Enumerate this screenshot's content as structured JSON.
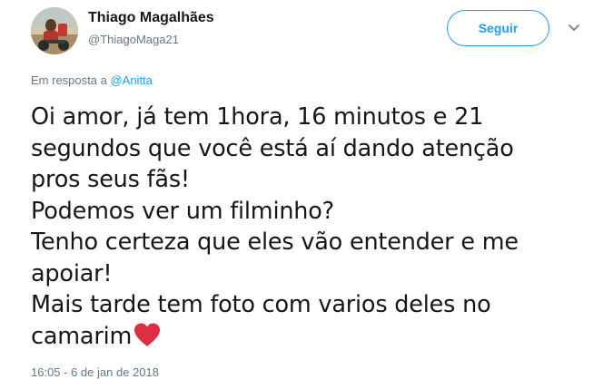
{
  "author": {
    "name": "Thiago Magalhães",
    "handle": "@ThiagoMaga21",
    "avatar_icon": "profile-photo"
  },
  "follow_button": {
    "label": "Seguir",
    "color": "#1da1f2"
  },
  "menu_icon": "chevron-down-icon",
  "reply_to": {
    "prefix": "Em resposta a",
    "mention": "@Anitta"
  },
  "tweet": {
    "lines": [
      "Oi amor, já tem 1hora, 16 minutos e 21",
      "segundos que você está aí dando atenção",
      "pros seus fãs!",
      "Podemos ver um filminho?",
      "Tenho certeza que eles vão entender e me",
      "apoiar!",
      "Mais tarde tem foto com varios deles no",
      "camarim"
    ],
    "emoji": "heart-icon",
    "emoji_color": "#dd2e44"
  },
  "timestamp": "16:05 - 6 de jan de 2018",
  "colors": {
    "text": "#14171a",
    "secondary": "#657786",
    "accent": "#1da1f2"
  }
}
